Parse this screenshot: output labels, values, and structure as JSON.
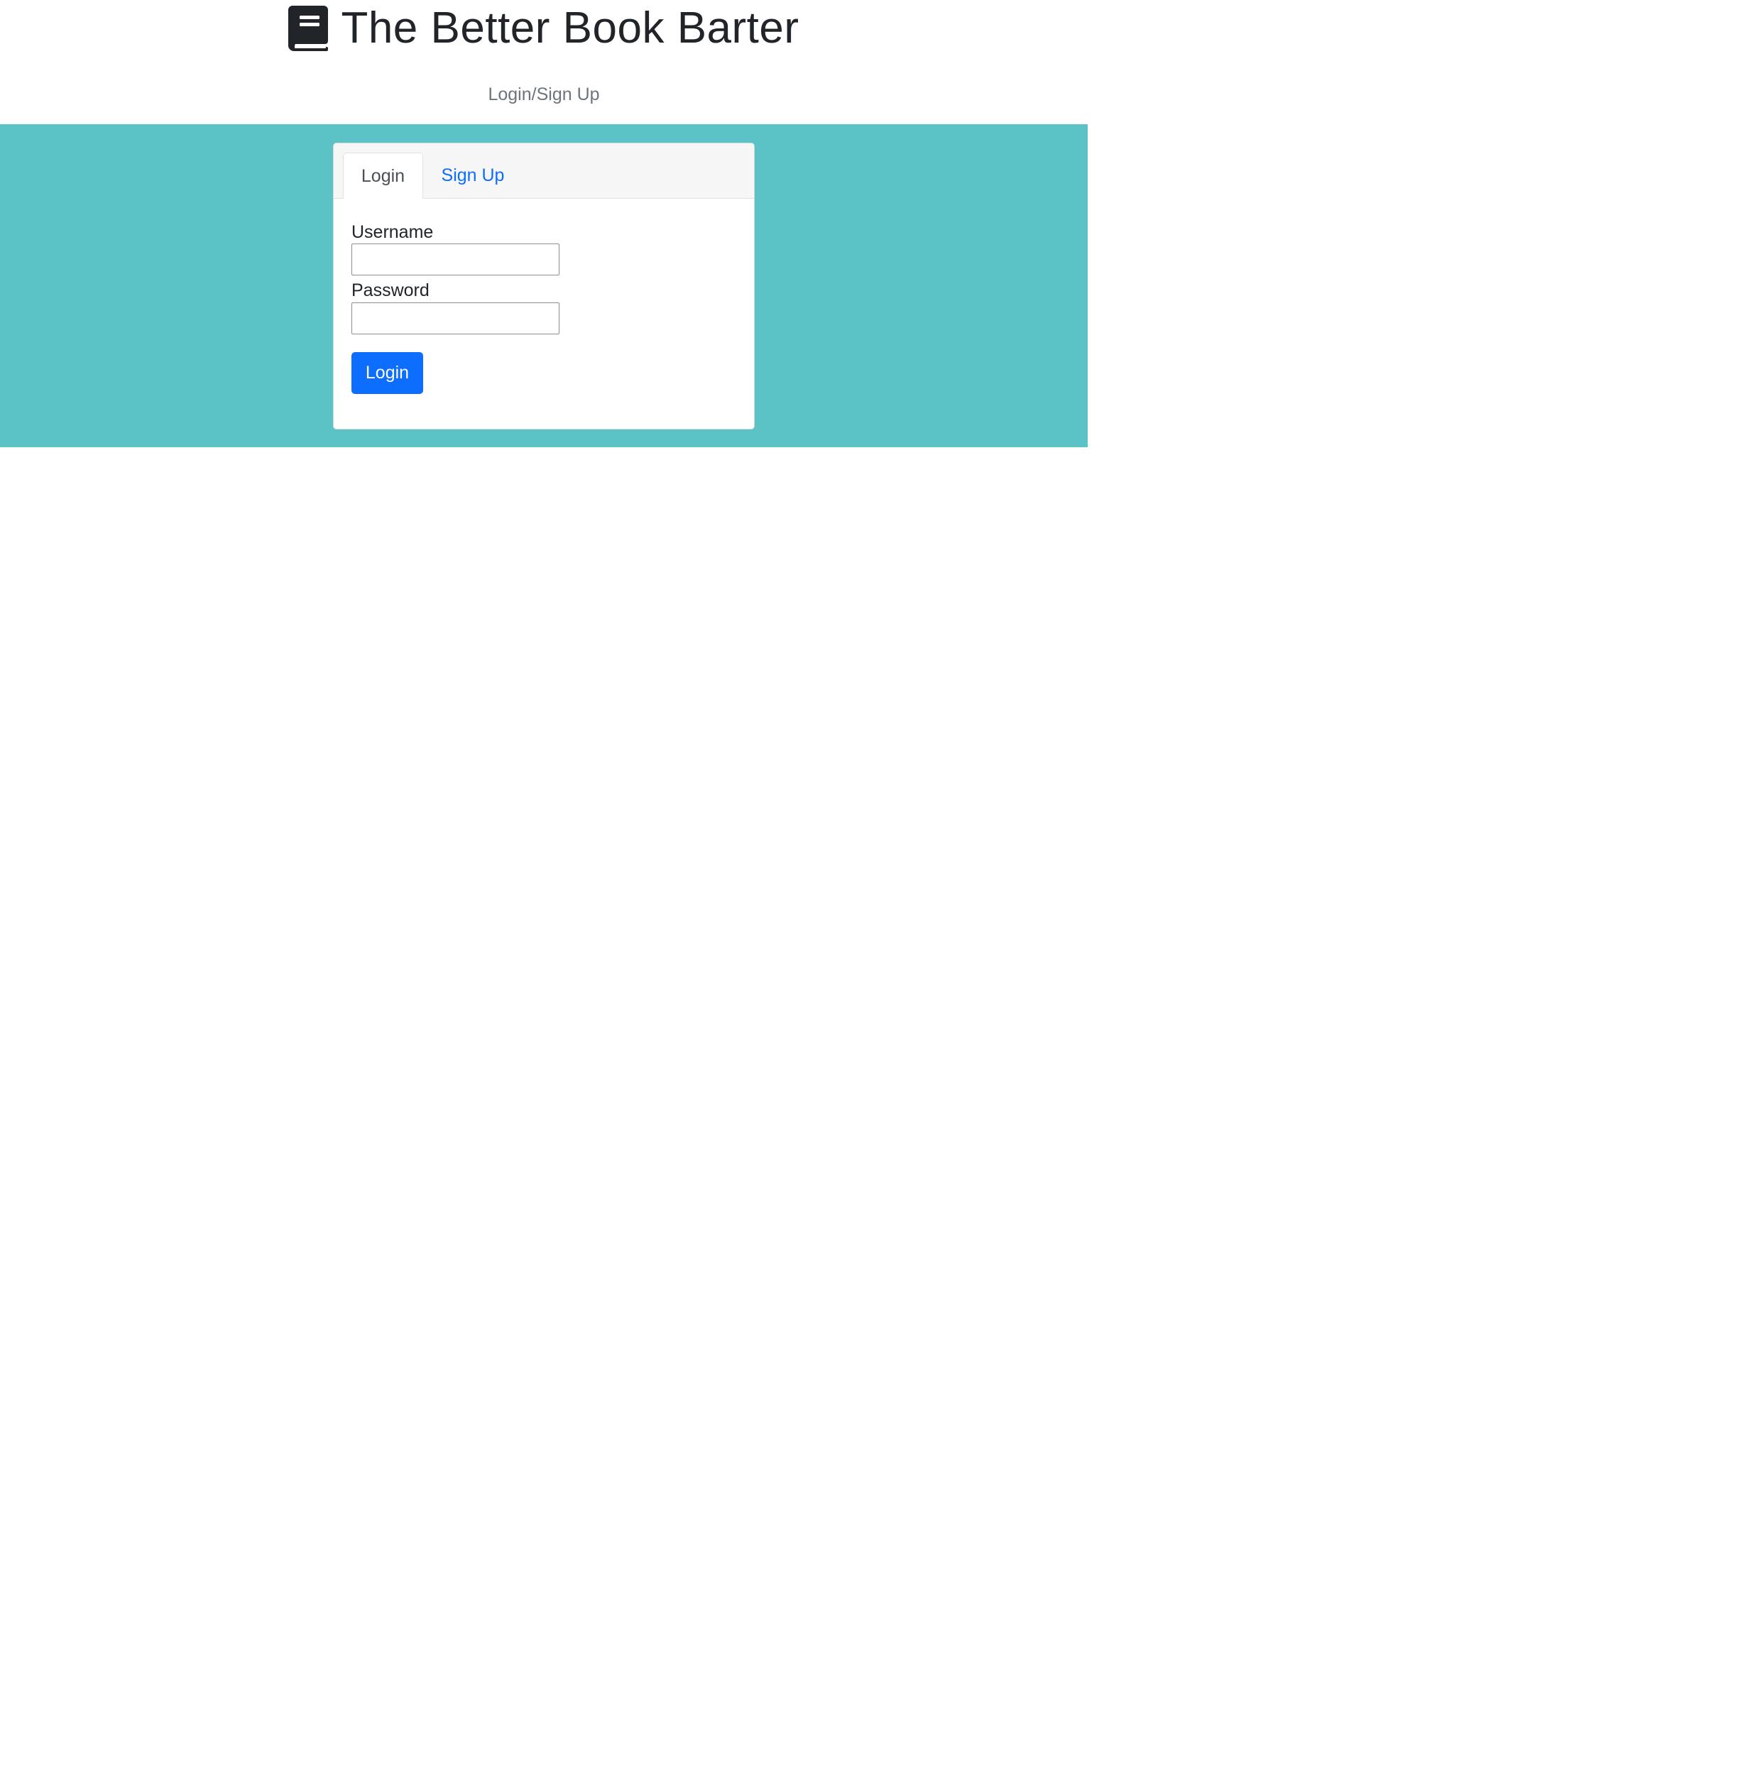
{
  "header": {
    "title": "The Better Book Barter",
    "icon": "book-icon",
    "subtitle": "Login/Sign Up"
  },
  "tabs": [
    {
      "label": "Login",
      "active": true
    },
    {
      "label": "Sign Up",
      "active": false
    }
  ],
  "form": {
    "username_label": "Username",
    "username_value": "",
    "password_label": "Password",
    "password_value": "",
    "submit_label": "Login"
  },
  "colors": {
    "band": "#5bc3c5",
    "primary": "#0d6efd",
    "link": "#0d6efd",
    "title": "#212529",
    "subtitle": "#6c757d"
  }
}
